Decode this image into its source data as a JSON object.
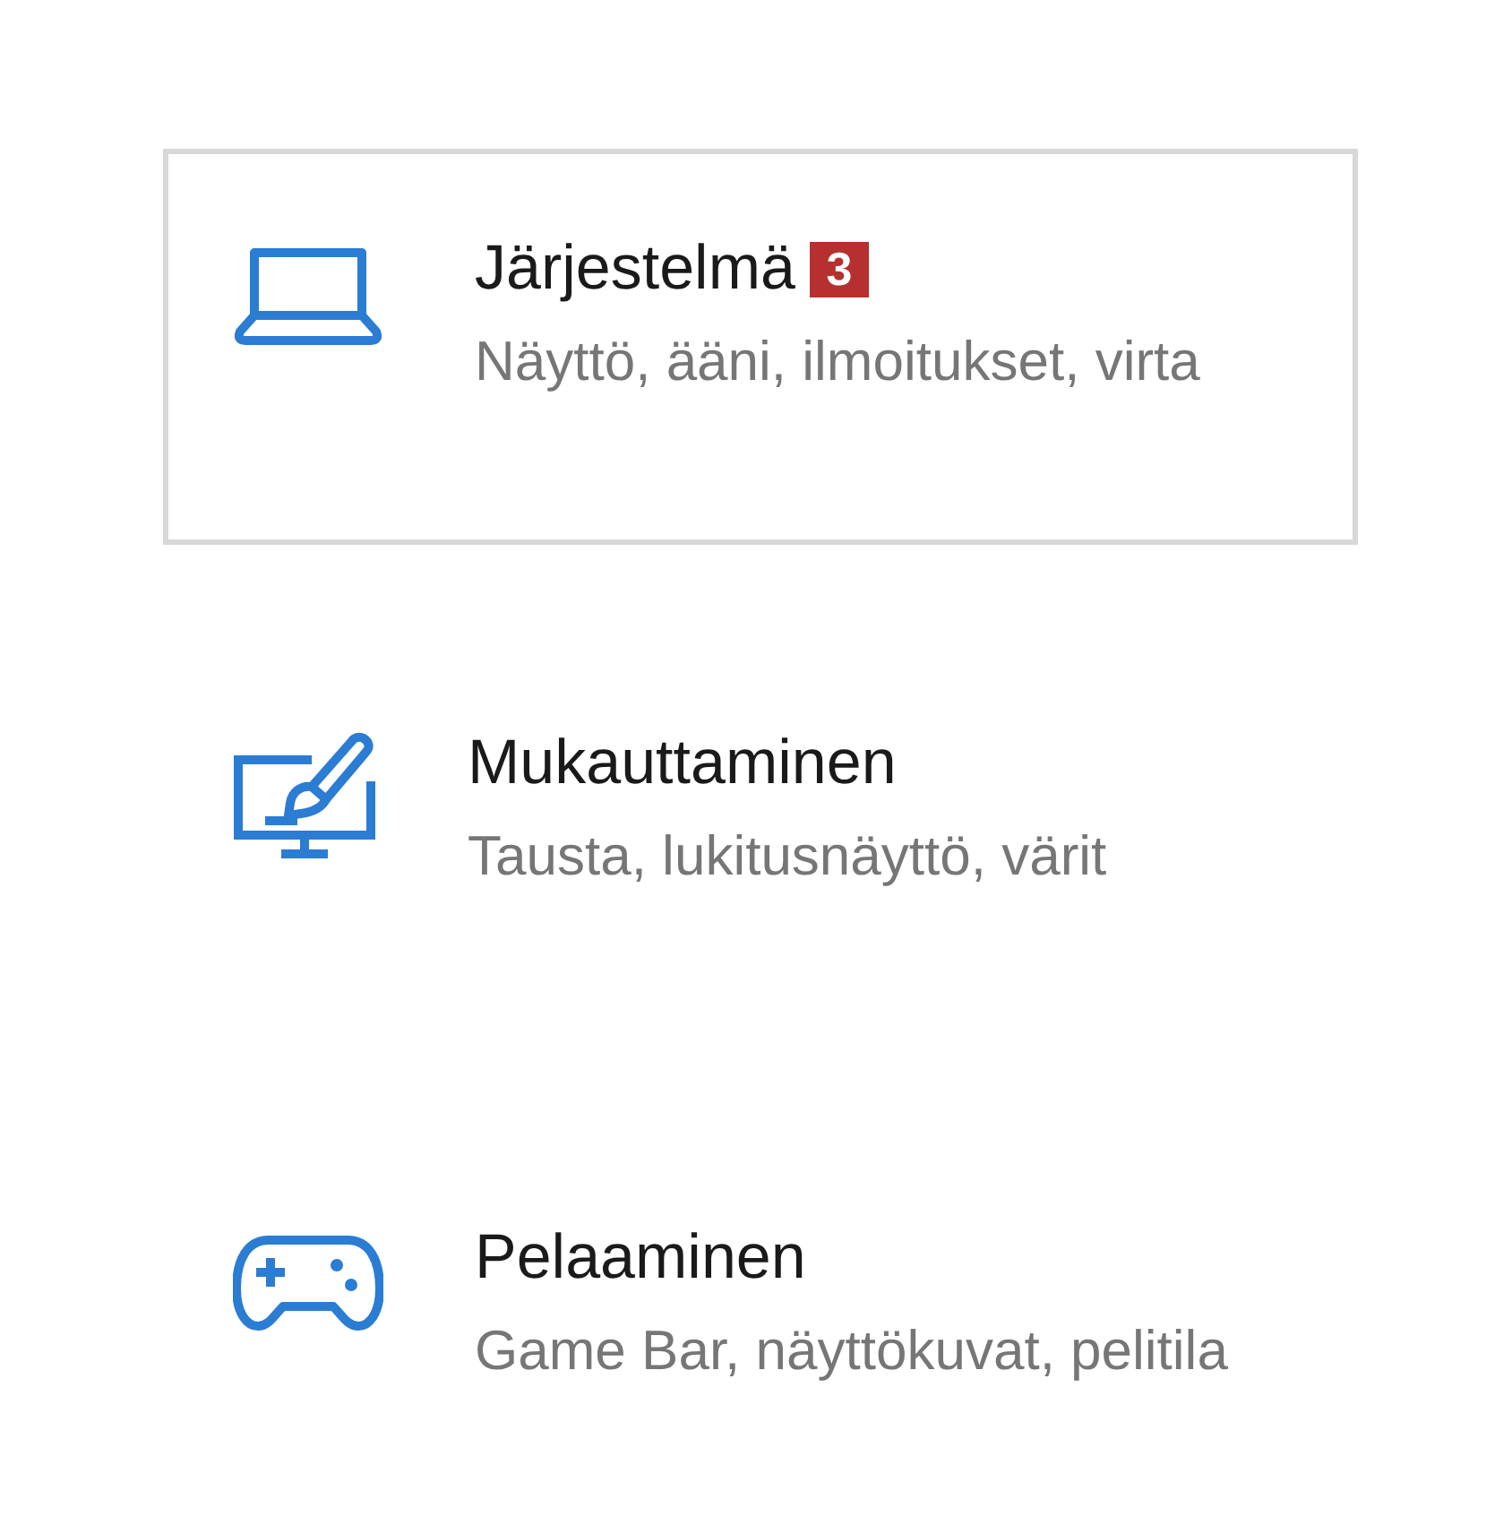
{
  "items": [
    {
      "title": "Järjestelmä",
      "badge": "3",
      "subtitle": "Näyttö, ääni, ilmoitukset, virta",
      "selected": true
    },
    {
      "title": "Mukauttaminen",
      "subtitle": "Tausta, lukitusnäyttö, värit",
      "selected": false
    },
    {
      "title": "Pelaaminen",
      "subtitle": "Game Bar, näyttökuvat, pelitila",
      "selected": false
    }
  ]
}
